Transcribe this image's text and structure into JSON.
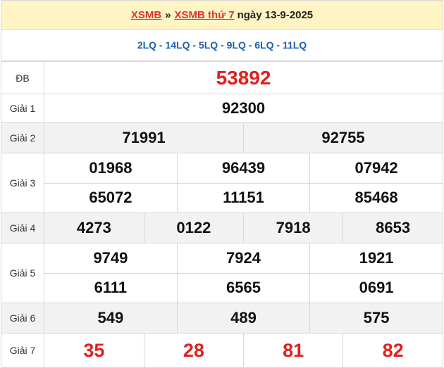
{
  "header": {
    "link1": "XSMB",
    "separator": "»",
    "link2": "XSMB thứ 7",
    "date_text": "ngày 13-9-2025"
  },
  "lq_line": "2LQ - 14LQ - 5LQ - 9LQ - 6LQ - 11LQ",
  "prizes": {
    "db": {
      "label": "ĐB",
      "numbers": [
        "53892"
      ]
    },
    "g1": {
      "label": "Giải 1",
      "numbers": [
        "92300"
      ]
    },
    "g2": {
      "label": "Giải 2",
      "numbers": [
        "71991",
        "92755"
      ]
    },
    "g3": {
      "label": "Giải 3",
      "numbers": [
        "01968",
        "96439",
        "07942",
        "65072",
        "11151",
        "85468"
      ]
    },
    "g4": {
      "label": "Giải 4",
      "numbers": [
        "4273",
        "0122",
        "7918",
        "8653"
      ]
    },
    "g5": {
      "label": "Giải 5",
      "numbers": [
        "9749",
        "7924",
        "1921",
        "6111",
        "6565",
        "0691"
      ]
    },
    "g6": {
      "label": "Giải 6",
      "numbers": [
        "549",
        "489",
        "575"
      ]
    },
    "g7": {
      "label": "Giải 7",
      "numbers": [
        "35",
        "28",
        "81",
        "82"
      ]
    }
  },
  "colors": {
    "header_bg": "#fff4c4",
    "link_red": "#e53131",
    "lq_blue": "#1f5fb0",
    "special_red": "#e02020"
  }
}
